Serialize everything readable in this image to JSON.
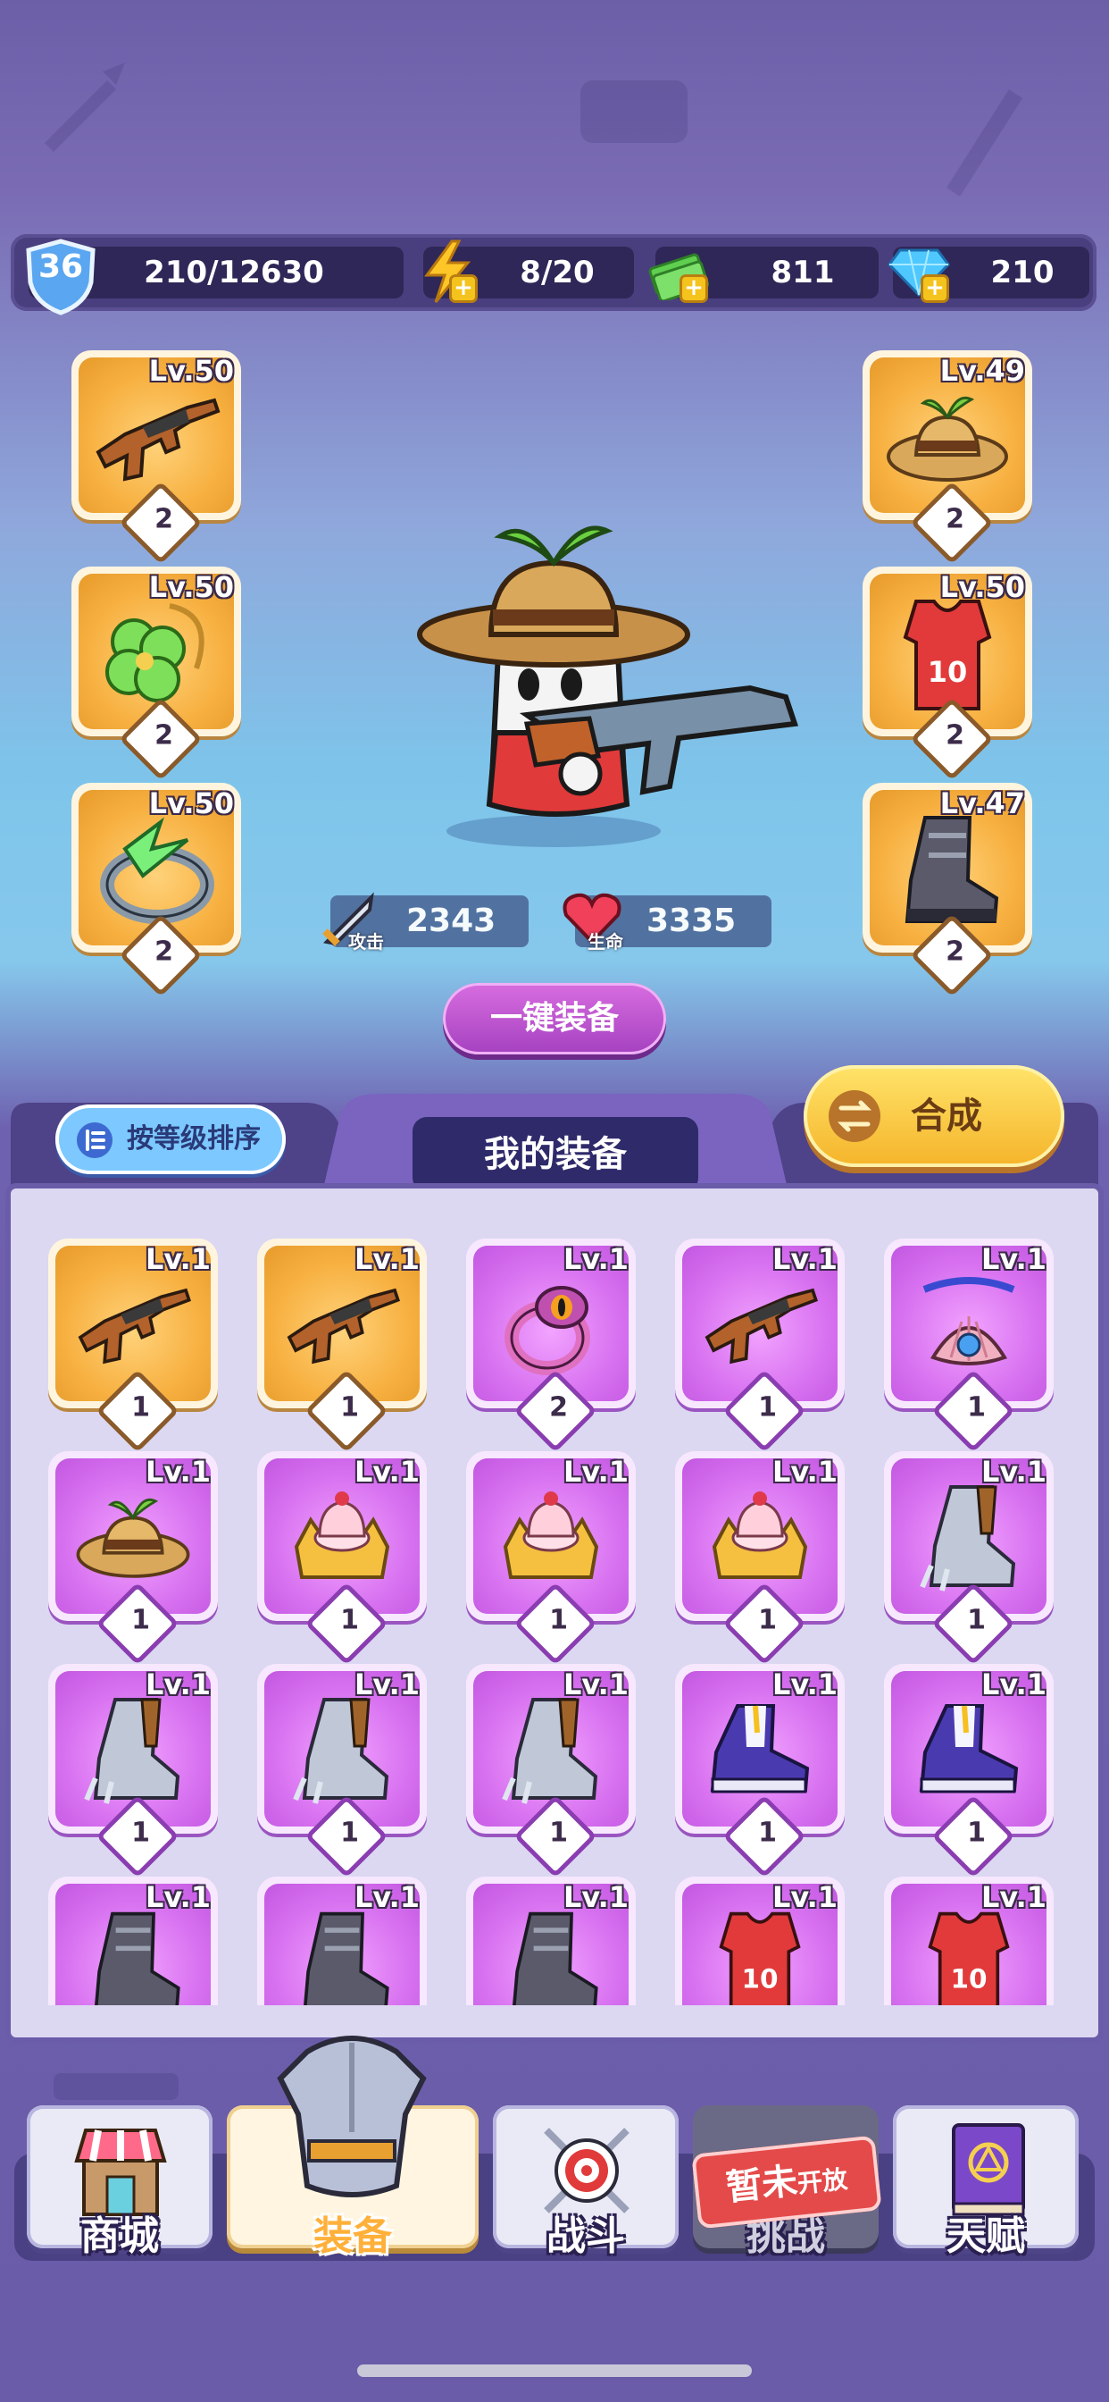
{
  "topbar": {
    "level": "36",
    "xp": "210/12630",
    "energy": "8/20",
    "cash": "811",
    "gems": "210"
  },
  "equipped": {
    "left": [
      {
        "level": "Lv.50",
        "count": "2",
        "item": "rifle-icon"
      },
      {
        "level": "Lv.50",
        "count": "2",
        "item": "clover-necklace-icon"
      },
      {
        "level": "Lv.50",
        "count": "2",
        "item": "ring-icon"
      }
    ],
    "right": [
      {
        "level": "Lv.49",
        "count": "2",
        "item": "straw-hat-icon"
      },
      {
        "level": "Lv.50",
        "count": "2",
        "item": "jersey-icon"
      },
      {
        "level": "Lv.47",
        "count": "2",
        "item": "boot-icon"
      }
    ]
  },
  "stats": {
    "attack_label": "攻击",
    "attack": "2343",
    "hp_label": "生命",
    "hp": "3335"
  },
  "buttons": {
    "equip_all": "一键装备",
    "sort": "按等级排序",
    "craft": "合成"
  },
  "inventory": {
    "title": "我的装备",
    "items": [
      {
        "level": "Lv.1",
        "count": "1",
        "rarity": "orange",
        "item": "rifle-icon"
      },
      {
        "level": "Lv.1",
        "count": "1",
        "rarity": "orange",
        "item": "rifle-icon"
      },
      {
        "level": "Lv.1",
        "count": "2",
        "rarity": "purple",
        "item": "eye-ring-icon"
      },
      {
        "level": "Lv.1",
        "count": "1",
        "rarity": "purple",
        "item": "rifle-icon"
      },
      {
        "level": "Lv.1",
        "count": "1",
        "rarity": "purple",
        "item": "shell-necklace-icon"
      },
      {
        "level": "Lv.1",
        "count": "1",
        "rarity": "purple",
        "item": "straw-hat-icon"
      },
      {
        "level": "Lv.1",
        "count": "1",
        "rarity": "purple",
        "item": "cake-crown-icon"
      },
      {
        "level": "Lv.1",
        "count": "1",
        "rarity": "purple",
        "item": "cake-crown-icon"
      },
      {
        "level": "Lv.1",
        "count": "1",
        "rarity": "purple",
        "item": "cake-crown-icon"
      },
      {
        "level": "Lv.1",
        "count": "1",
        "rarity": "purple",
        "item": "armored-boot-icon"
      },
      {
        "level": "Lv.1",
        "count": "1",
        "rarity": "purple",
        "item": "armored-boot-icon"
      },
      {
        "level": "Lv.1",
        "count": "1",
        "rarity": "purple",
        "item": "armored-boot-icon"
      },
      {
        "level": "Lv.1",
        "count": "1",
        "rarity": "purple",
        "item": "armored-boot-icon"
      },
      {
        "level": "Lv.1",
        "count": "1",
        "rarity": "purple",
        "item": "sneaker-icon"
      },
      {
        "level": "Lv.1",
        "count": "1",
        "rarity": "purple",
        "item": "sneaker-icon"
      },
      {
        "level": "Lv.1",
        "count": "",
        "rarity": "purple",
        "item": "boot-icon"
      },
      {
        "level": "Lv.1",
        "count": "",
        "rarity": "purple",
        "item": "boot-icon"
      },
      {
        "level": "Lv.1",
        "count": "",
        "rarity": "purple",
        "item": "boot-icon"
      },
      {
        "level": "Lv.1",
        "count": "",
        "rarity": "purple",
        "item": "jersey-icon"
      },
      {
        "level": "Lv.1",
        "count": "",
        "rarity": "purple",
        "item": "jersey-icon"
      }
    ]
  },
  "nav": {
    "shop": "商城",
    "equipment": "装备",
    "battle": "战斗",
    "challenge": "挑战",
    "talent": "天赋",
    "challenge_badge_a": "暂未",
    "challenge_badge_b": "开放",
    "active": "equipment"
  },
  "colors": {
    "orange_rarity": "#f7b040",
    "purple_rarity": "#d770f0",
    "active_tab": "#ffb03a"
  }
}
